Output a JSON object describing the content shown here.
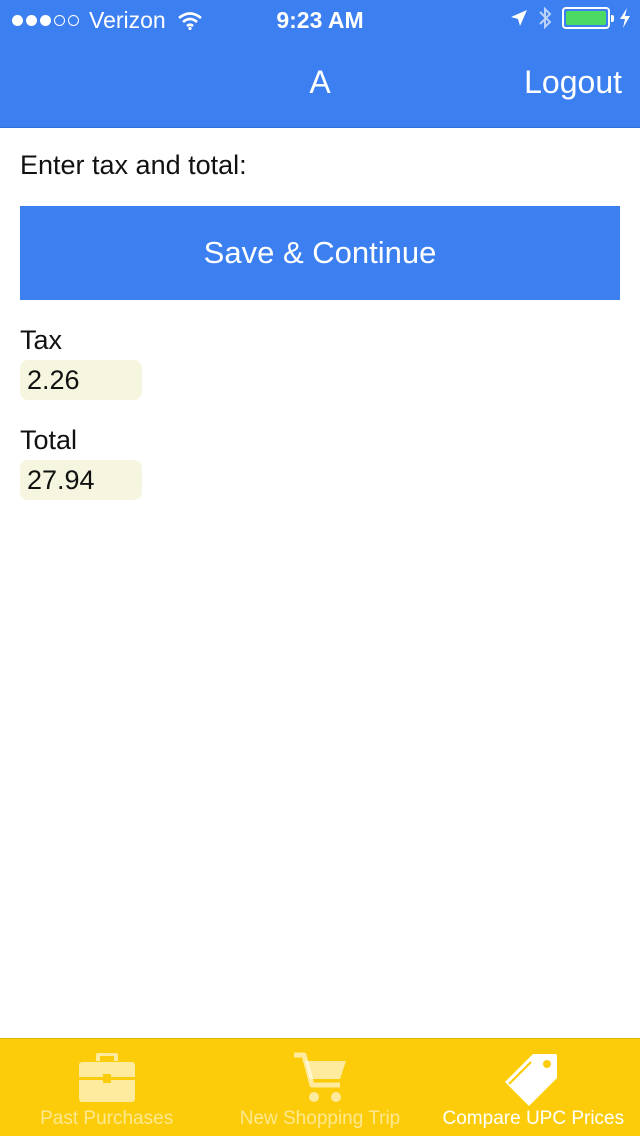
{
  "status_bar": {
    "carrier": "Verizon",
    "time": "9:23 AM",
    "signal_bars_filled": 3,
    "signal_bars_total": 5,
    "icons": [
      "wifi-icon",
      "location-arrow-icon",
      "bluetooth-icon",
      "battery-icon",
      "charging-bolt-icon"
    ]
  },
  "nav": {
    "title": "A",
    "logout_label": "Logout"
  },
  "form": {
    "instructions": "Enter tax and total:",
    "save_label": "Save & Continue",
    "tax_label": "Tax",
    "tax_value": "2.26",
    "total_label": "Total",
    "total_value": "27.94"
  },
  "tabs": [
    {
      "label": "Past Purchases",
      "icon": "briefcase-icon",
      "active": false
    },
    {
      "label": "New Shopping Trip",
      "icon": "shopping-cart-icon",
      "active": false
    },
    {
      "label": "Compare UPC Prices",
      "icon": "price-tag-icon",
      "active": true
    }
  ],
  "colors": {
    "header_blue": "#3b7ff0",
    "tabbar_yellow": "#fccc0a",
    "input_bg": "#f6f5df"
  }
}
